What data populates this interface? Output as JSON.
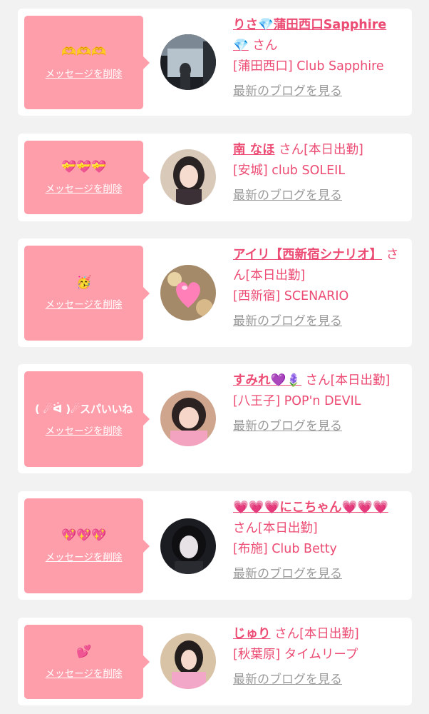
{
  "colors": {
    "accent": "#ec4b73",
    "bubble": "#ff9eab",
    "link_gray": "#9b9b9b",
    "background": "#f3f2f3"
  },
  "common": {
    "delete_label": "メッセージを削除",
    "blog_label": "最新のブログを見る",
    "san": "さん"
  },
  "cards": [
    {
      "comment": "🫶🫶🫶",
      "name": "りさ💎蒲田西口Sapphire💎",
      "suffix": "さん",
      "shop": "[蒲田西口] Club Sapphire"
    },
    {
      "comment": "💝💝💝",
      "name": "南 なほ",
      "suffix": "さん[本日出勤]",
      "shop": "[安城] club SOLEIL"
    },
    {
      "comment": "🥳",
      "name": "アイリ【西新宿シナリオ】",
      "suffix": "さん[本日出勤]",
      "shop": "[西新宿] SCENARIO"
    },
    {
      "comment": "( ☄ᐛ )☄スパいいね",
      "name": "すみれ💜🪻",
      "suffix": "さん[本日出勤]",
      "shop": "[八王子] POP'n DEVIL"
    },
    {
      "comment": "💖💖💖",
      "name": "💗💗💗にこちゃん💗💗💗",
      "suffix": "さん[本日出勤]",
      "shop": "[布施] Club Betty"
    },
    {
      "comment": "💕",
      "name": "じゅり",
      "suffix": "さん[本日出勤]",
      "shop": "[秋葉原] タイムリープ"
    }
  ]
}
